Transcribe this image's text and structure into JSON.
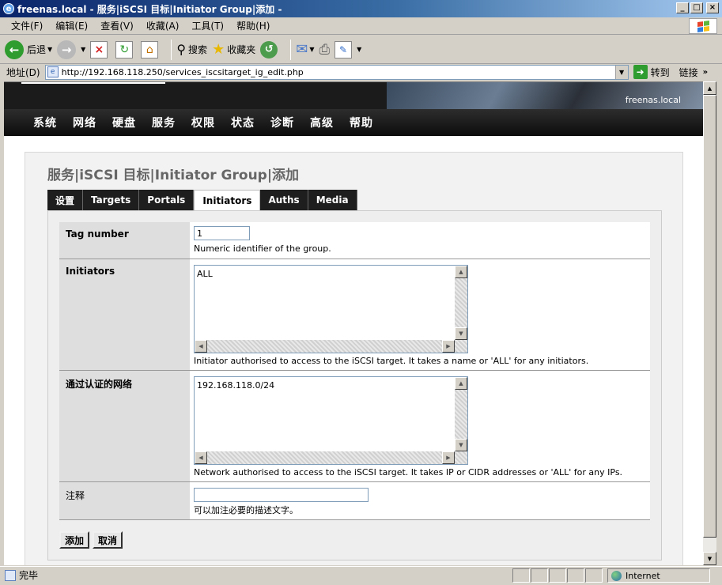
{
  "window": {
    "title": "freenas.local - 服务|iSCSI 目标|Initiator Group|添加 -",
    "controls": [
      "_",
      "□",
      "×"
    ]
  },
  "menu": [
    "文件(F)",
    "编辑(E)",
    "查看(V)",
    "收藏(A)",
    "工具(T)",
    "帮助(H)"
  ],
  "toolbar": {
    "back": "后退",
    "search": "搜索",
    "favorites": "收藏夹"
  },
  "address": {
    "label": "地址(D)",
    "url": "http://192.168.118.250/services_iscsitarget_ig_edit.php",
    "go": "转到",
    "links": "链接"
  },
  "banner": {
    "host": "freenas.local"
  },
  "nav": [
    "系统",
    "网络",
    "硬盘",
    "服务",
    "权限",
    "状态",
    "诊断",
    "高级",
    "帮助"
  ],
  "page": {
    "title": "服务|iSCSI 目标|Initiator Group|添加",
    "tabs": [
      {
        "label": "设置",
        "active": false
      },
      {
        "label": "Targets",
        "active": false
      },
      {
        "label": "Portals",
        "active": false
      },
      {
        "label": "Initiators",
        "active": true
      },
      {
        "label": "Auths",
        "active": false
      },
      {
        "label": "Media",
        "active": false
      }
    ]
  },
  "form": {
    "tag": {
      "label": "Tag number",
      "value": "1",
      "hint": "Numeric identifier of the group."
    },
    "initiators": {
      "label": "Initiators",
      "value": "ALL",
      "hint": "Initiator authorised to access to the iSCSI target. It takes a name or 'ALL' for any initiators."
    },
    "network": {
      "label": "通过认证的网络",
      "value": "192.168.118.0/24",
      "hint": "Network authorised to access to the iSCSI target. It takes IP or CIDR addresses or 'ALL' for any IPs."
    },
    "comment": {
      "label": "注释",
      "value": "",
      "hint": "可以加注必要的描述文字。"
    },
    "add_button": "添加",
    "cancel_button": "取消"
  },
  "status": {
    "text": "完毕",
    "zone": "Internet"
  }
}
